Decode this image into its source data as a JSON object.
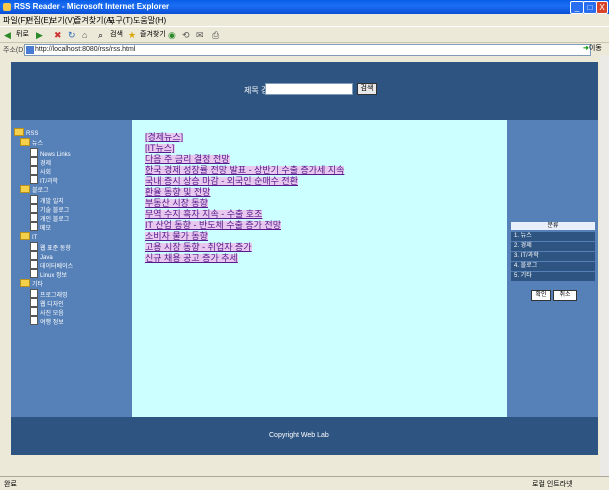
{
  "window": {
    "title": "RSS Reader - Microsoft Internet Explorer",
    "min_label": "_",
    "max_label": "□",
    "close_label": "X"
  },
  "menu": [
    "파일(F)",
    "편집(E)",
    "보기(V)",
    "즐겨찾기(A)",
    "도구(T)",
    "도움말(H)"
  ],
  "toolbar": {
    "back_label": "뒤로",
    "search_label": "검색",
    "favorites_label": "즐겨찾기"
  },
  "address": {
    "label": "주소(D)",
    "url": "http://localhost:8080/rss/rss.html",
    "go_label": "이동"
  },
  "header": {
    "search_label": "제목 검색",
    "search_value": "",
    "search_button": "검색"
  },
  "tree": [
    {
      "label": "RSS",
      "kind": "folder"
    },
    {
      "label": "뉴스",
      "kind": "folder"
    },
    {
      "label": "News Links",
      "kind": "doc"
    },
    {
      "label": "경제",
      "kind": "doc"
    },
    {
      "label": "사회",
      "kind": "doc"
    },
    {
      "label": "IT/과학",
      "kind": "doc"
    },
    {
      "label": "블로그",
      "kind": "folder"
    },
    {
      "label": "개발 일지",
      "kind": "doc"
    },
    {
      "label": "기술 블로그",
      "kind": "doc"
    },
    {
      "label": "개인 블로그",
      "kind": "doc"
    },
    {
      "label": "메모",
      "kind": "doc"
    },
    {
      "label": "IT",
      "kind": "folder"
    },
    {
      "label": "웹 표준 동향",
      "kind": "doc"
    },
    {
      "label": "Java",
      "kind": "doc"
    },
    {
      "label": "데이터베이스",
      "kind": "doc"
    },
    {
      "label": "Linux 정보",
      "kind": "doc"
    },
    {
      "label": "기타",
      "kind": "folder"
    },
    {
      "label": "프로그래밍",
      "kind": "doc"
    },
    {
      "label": "웹 디자인",
      "kind": "doc"
    },
    {
      "label": "사진 모음",
      "kind": "doc"
    },
    {
      "label": "여행 정보",
      "kind": "doc"
    }
  ],
  "links": [
    "[경제뉴스]",
    "[IT뉴스]",
    "다음 주 금리 결정 전망",
    "한국 경제 성장률 전망 발표 - 상반기 수출 증가세 지속",
    "국내 증시 상승 마감 - 외국인 순매수 전환",
    "환율 동향 및 전망",
    "부동산 시장 동향",
    "무역 수지 흑자 지속 - 수출 호조",
    "IT 산업 동향 - 반도체 수출 증가 전망",
    "소비자 물가 동향",
    "고용 시장 동향 - 취업자 증가",
    "신규 채용 공고 증가 추세"
  ],
  "right_panel": {
    "header": "분류",
    "items": [
      "1. 뉴스",
      "2. 경제",
      "3. IT/과학",
      "4. 블로그",
      "5. 기타"
    ],
    "btn_ok": "확인",
    "btn_cancel": "취소"
  },
  "footer": {
    "copyright": "Copyright Web Lab"
  },
  "status": {
    "left": "완료",
    "right": "로컬 인트라넷"
  }
}
